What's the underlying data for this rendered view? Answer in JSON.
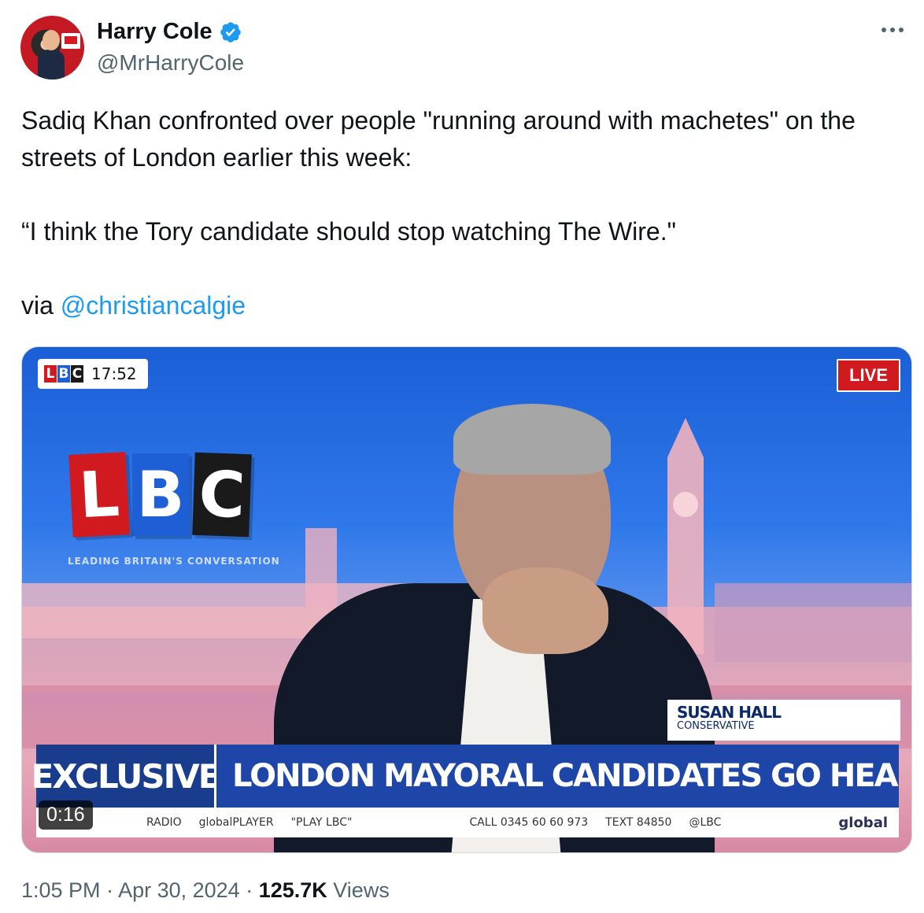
{
  "author": {
    "display_name": "Harry Cole",
    "handle": "@MrHarryCole",
    "verified": true
  },
  "tweet": {
    "line1": "Sadiq Khan confronted over people \"running around with machetes\" on the streets of London earlier this week:",
    "line2": "“I think the Tory candidate should stop watching The Wire.\"",
    "via_prefix": "via ",
    "via_mention": "@christiancalgie"
  },
  "video": {
    "corner_logo": [
      "L",
      "B",
      "C"
    ],
    "clock": "17:52",
    "live_label": "LIVE",
    "big_logo": [
      "L",
      "B",
      "C"
    ],
    "tagline": "LEADING BRITAIN'S CONVERSATION",
    "name_tag_name": "SUSAN HALL",
    "name_tag_party": "CONSERVATIVE",
    "strap_label": "EXCLUSIVE",
    "headline": "LONDON MAYORAL CANDIDATES GO HEAD-TO-HEAD",
    "ticker": {
      "radio": "RADIO",
      "globalplayer": "globalPLAYER",
      "play": "\"PLAY LBC\"",
      "call": "CALL 0345 60 60 973",
      "text": "TEXT 84850",
      "social": "@LBC",
      "brand": "global"
    },
    "duration": "0:16",
    "colors": {
      "l": "#d11a1f",
      "b": "#1e5fd6",
      "c": "#1a1a1a"
    }
  },
  "meta": {
    "time": "1:05 PM",
    "sep1": " · ",
    "date": "Apr 30, 2024",
    "sep2": " · ",
    "views_count": "125.7K",
    "views_label": " Views"
  },
  "icons": {
    "verified": "verified-badge-icon",
    "more": "more-dots-icon"
  }
}
